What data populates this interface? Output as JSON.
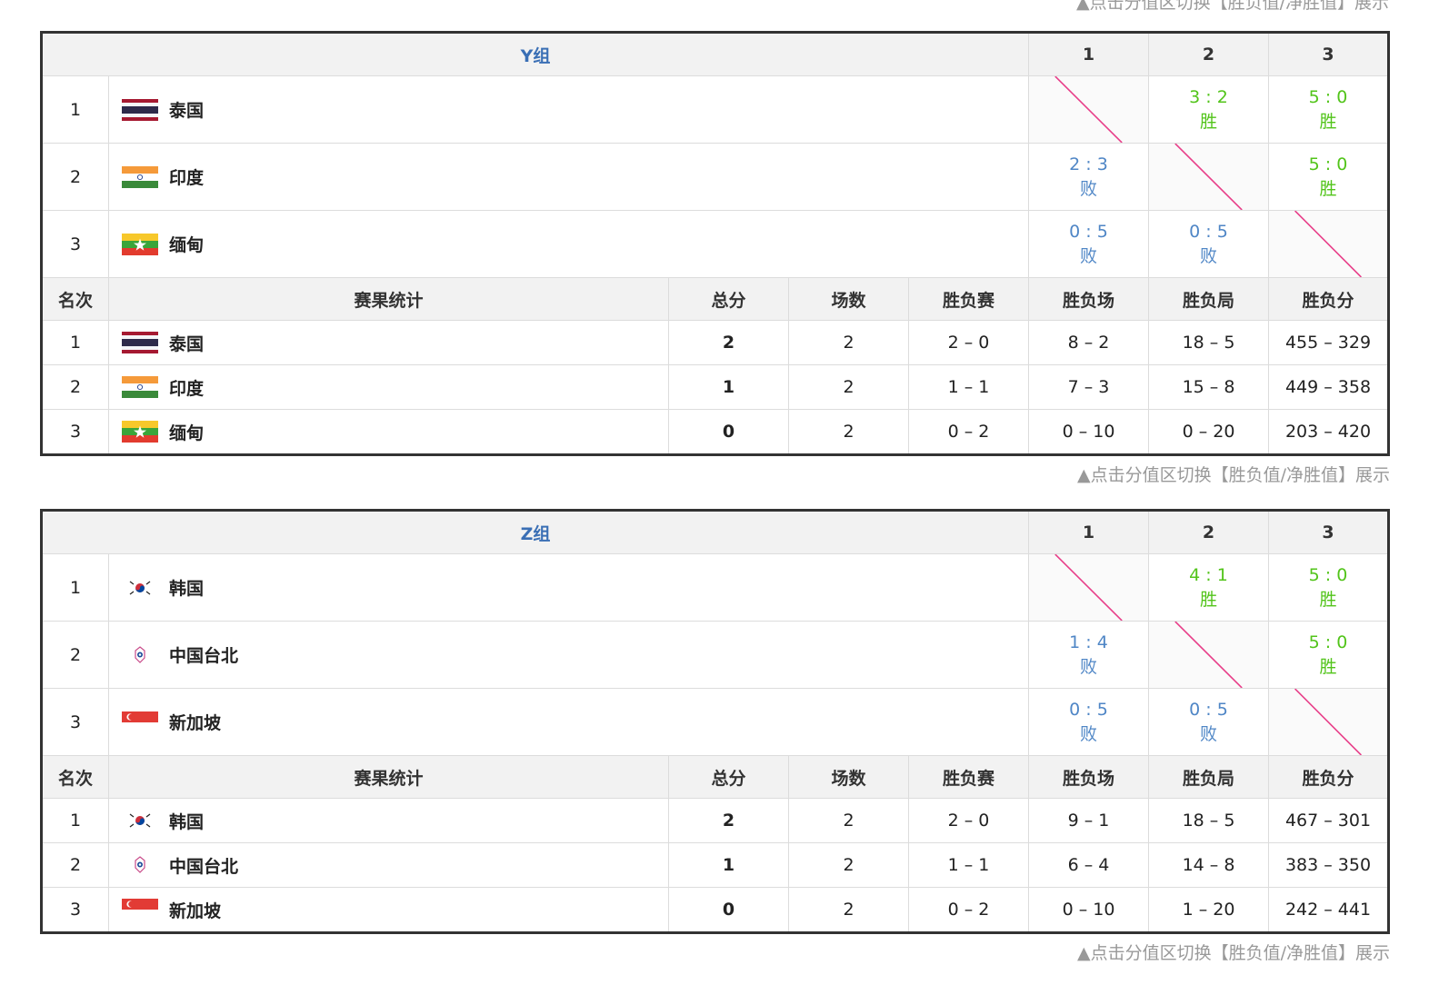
{
  "note": "▲点击分值区切换【胜负值/净胜值】展示",
  "colors": {
    "win": "#52c41a",
    "lose": "#4f86c6",
    "group_title": "#3a6fb5",
    "diagonal": "#e8408a"
  },
  "columns": {
    "rank": "名次",
    "stats": "赛果统计",
    "points": "总分",
    "played": "场数",
    "ties_wl": "胜负赛",
    "matches_wl": "胜负场",
    "games_wl": "胜负局",
    "points_wl": "胜负分"
  },
  "groups": [
    {
      "name": "Y组",
      "col_nums": [
        "1",
        "2",
        "3"
      ],
      "matrix": [
        {
          "rank": "1",
          "team": "泰国",
          "flag": "thailand-flag-icon",
          "cells": [
            null,
            {
              "score": "3 : 2",
              "result": "胜"
            },
            {
              "score": "5 : 0",
              "result": "胜"
            }
          ]
        },
        {
          "rank": "2",
          "team": "印度",
          "flag": "india-flag-icon",
          "cells": [
            {
              "score": "2 : 3",
              "result": "败"
            },
            null,
            {
              "score": "5 : 0",
              "result": "胜"
            }
          ]
        },
        {
          "rank": "3",
          "team": "缅甸",
          "flag": "myanmar-flag-icon",
          "cells": [
            {
              "score": "0 : 5",
              "result": "败"
            },
            {
              "score": "0 : 5",
              "result": "败"
            },
            null
          ]
        }
      ],
      "standings": [
        {
          "rank": "1",
          "team": "泰国",
          "flag": "thailand-flag-icon",
          "points": "2",
          "played": "2",
          "ties": "2 – 0",
          "matches": "8 – 2",
          "games": "18 – 5",
          "pts": "455 – 329"
        },
        {
          "rank": "2",
          "team": "印度",
          "flag": "india-flag-icon",
          "points": "1",
          "played": "2",
          "ties": "1 – 1",
          "matches": "7 – 3",
          "games": "15 – 8",
          "pts": "449 – 358"
        },
        {
          "rank": "3",
          "team": "缅甸",
          "flag": "myanmar-flag-icon",
          "points": "0",
          "played": "2",
          "ties": "0 – 2",
          "matches": "0 – 10",
          "games": "0 – 20",
          "pts": "203 – 420"
        }
      ]
    },
    {
      "name": "Z组",
      "col_nums": [
        "1",
        "2",
        "3"
      ],
      "matrix": [
        {
          "rank": "1",
          "team": "韩国",
          "flag": "korea-flag-icon",
          "cells": [
            null,
            {
              "score": "4 : 1",
              "result": "胜"
            },
            {
              "score": "5 : 0",
              "result": "胜"
            }
          ]
        },
        {
          "rank": "2",
          "team": "中国台北",
          "flag": "chinese-taipei-flag-icon",
          "cells": [
            {
              "score": "1 : 4",
              "result": "败"
            },
            null,
            {
              "score": "5 : 0",
              "result": "胜"
            }
          ]
        },
        {
          "rank": "3",
          "team": "新加坡",
          "flag": "singapore-flag-icon",
          "cells": [
            {
              "score": "0 : 5",
              "result": "败"
            },
            {
              "score": "0 : 5",
              "result": "败"
            },
            null
          ]
        }
      ],
      "standings": [
        {
          "rank": "1",
          "team": "韩国",
          "flag": "korea-flag-icon",
          "points": "2",
          "played": "2",
          "ties": "2 – 0",
          "matches": "9 – 1",
          "games": "18 – 5",
          "pts": "467 – 301"
        },
        {
          "rank": "2",
          "team": "中国台北",
          "flag": "chinese-taipei-flag-icon",
          "points": "1",
          "played": "2",
          "ties": "1 – 1",
          "matches": "6 – 4",
          "games": "14 – 8",
          "pts": "383 – 350"
        },
        {
          "rank": "3",
          "team": "新加坡",
          "flag": "singapore-flag-icon",
          "points": "0",
          "played": "2",
          "ties": "0 – 2",
          "matches": "0 – 10",
          "games": "1 – 20",
          "pts": "242 – 441"
        }
      ]
    }
  ]
}
